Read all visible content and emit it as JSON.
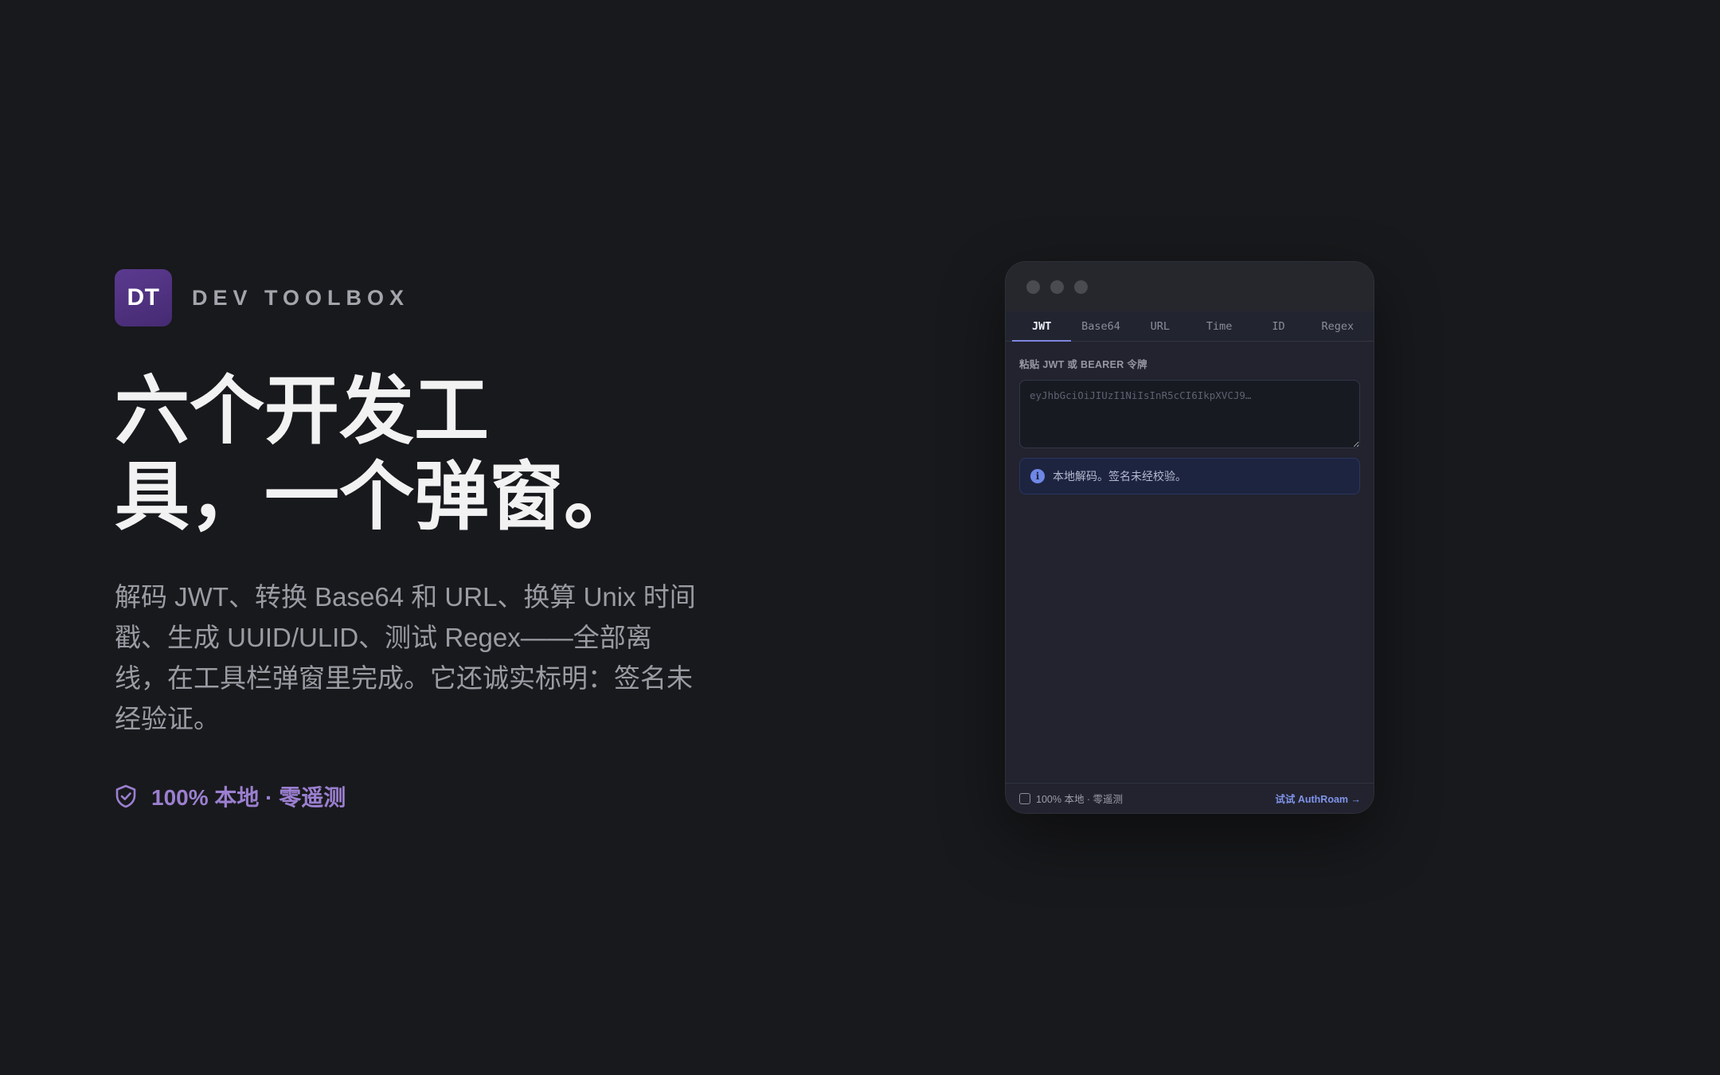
{
  "colors": {
    "background": "#18191c",
    "accent": "#9b7fd0",
    "brand_logo": "#4b2e7a",
    "popup_link": "#7f93ea",
    "tab_indicator": "#7e86e0"
  },
  "brand": {
    "logo_text": "DT",
    "name": "DEV TOOLBOX"
  },
  "hero": {
    "headline_line1": "六个开发工",
    "headline_line2": "具，一个弹窗。",
    "lead": "解码 JWT、转换 Base64 和 URL、换算 Unix 时间戳、生成 UUID/ULID、测试 Regex——全部离线，在工具栏弹窗里完成。它还诚实标明：签名未经验证。",
    "privacy_icon": "shield-check-icon",
    "privacy_text": "100% 本地 · 零遥测"
  },
  "popup": {
    "tabs": [
      {
        "label": "JWT",
        "active": true
      },
      {
        "label": "Base64",
        "active": false
      },
      {
        "label": "URL",
        "active": false
      },
      {
        "label": "Time",
        "active": false
      },
      {
        "label": "ID",
        "active": false
      },
      {
        "label": "Regex",
        "active": false
      }
    ],
    "field_label": "粘贴 JWT 或 BEARER 令牌",
    "input_placeholder": "eyJhbGciOiJIUzI1NiIsInR5cCI6IkpXVCJ9…",
    "input_value": "",
    "notice_icon": "info-icon",
    "notice_text": "本地解码。签名未经校验。",
    "footer_privacy": "100% 本地 · 零遥测",
    "footer_link": "试试 AuthRoam →"
  }
}
